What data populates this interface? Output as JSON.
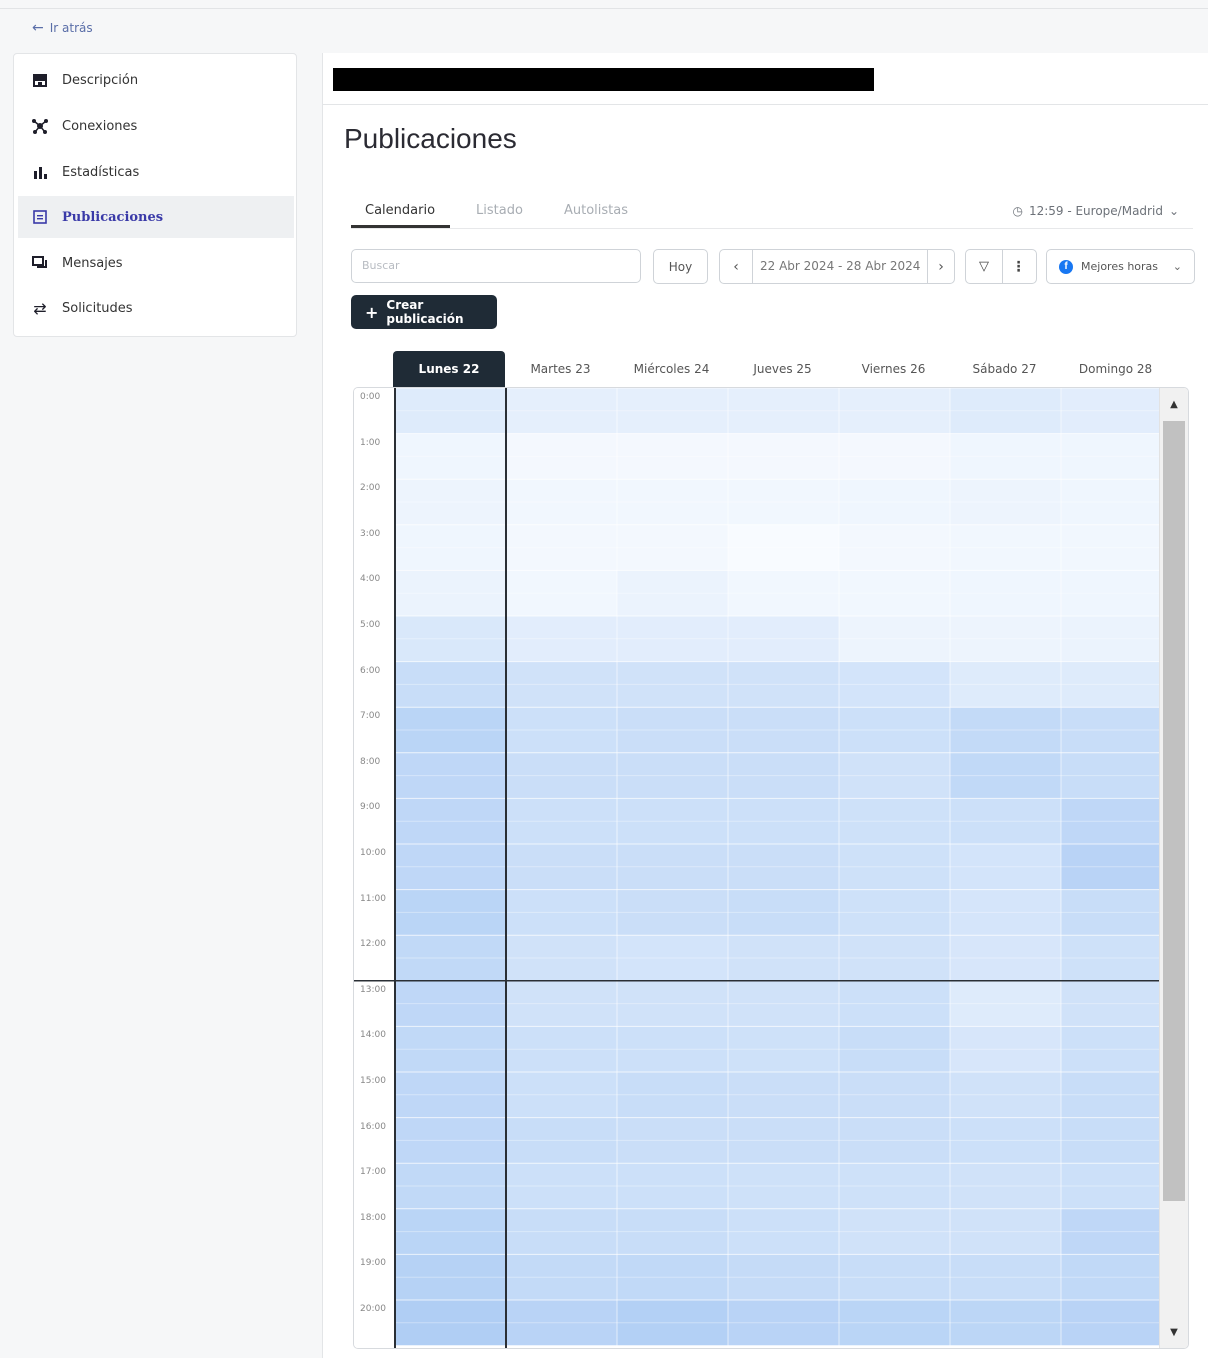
{
  "nav": {
    "back_label": "Ir atrás"
  },
  "sidebar": {
    "items": [
      {
        "label": "Descripción",
        "icon": "storefront-icon"
      },
      {
        "label": "Conexiones",
        "icon": "network-icon"
      },
      {
        "label": "Estadísticas",
        "icon": "bar-chart-icon"
      },
      {
        "label": "Publicaciones",
        "icon": "calendar-icon",
        "active": true
      },
      {
        "label": "Mensajes",
        "icon": "chat-icon"
      },
      {
        "label": "Solicitudes",
        "icon": "swap-arrows-icon"
      }
    ]
  },
  "page": {
    "title": "Publicaciones"
  },
  "tabs": {
    "calendar": "Calendario",
    "list": "Listado",
    "autolists": "Autolistas"
  },
  "timezone": {
    "label": "12:59 - Europe/Madrid"
  },
  "toolbar": {
    "search_placeholder": "Buscar",
    "today_label": "Hoy",
    "date_range": "22 Abr 2024 - 28 Abr 2024",
    "best_hours_label": "Mejores horas",
    "create_label": "Crear publicación"
  },
  "calendar": {
    "days": [
      "Lunes 22",
      "Martes 23",
      "Miércoles 24",
      "Jueves 25",
      "Viernes 26",
      "Sábado 27",
      "Domingo 28"
    ],
    "active_day_index": 0,
    "hours": [
      "0:00",
      "1:00",
      "2:00",
      "3:00",
      "4:00",
      "5:00",
      "6:00",
      "7:00",
      "8:00",
      "9:00",
      "10:00",
      "11:00",
      "12:00",
      "13:00",
      "14:00",
      "15:00",
      "16:00",
      "17:00",
      "18:00",
      "19:00",
      "20:00"
    ],
    "current_time_hour": 13.0,
    "best_hours_intensity": [
      [
        0.3,
        0.1,
        0.12,
        0.1,
        0.15,
        0.35,
        0.55,
        0.7,
        0.65,
        0.65,
        0.65,
        0.7,
        0.62,
        0.65,
        0.62,
        0.65,
        0.65,
        0.62,
        0.7,
        0.75,
        0.82
      ],
      [
        0.22,
        0.05,
        0.08,
        0.06,
        0.08,
        0.25,
        0.45,
        0.5,
        0.52,
        0.5,
        0.52,
        0.5,
        0.45,
        0.45,
        0.5,
        0.5,
        0.55,
        0.5,
        0.55,
        0.6,
        0.72
      ],
      [
        0.22,
        0.05,
        0.08,
        0.06,
        0.15,
        0.25,
        0.45,
        0.52,
        0.52,
        0.5,
        0.52,
        0.52,
        0.42,
        0.45,
        0.5,
        0.55,
        0.52,
        0.5,
        0.55,
        0.62,
        0.78
      ],
      [
        0.22,
        0.05,
        0.08,
        0.0,
        0.08,
        0.25,
        0.45,
        0.52,
        0.52,
        0.5,
        0.52,
        0.55,
        0.45,
        0.45,
        0.48,
        0.52,
        0.52,
        0.48,
        0.5,
        0.58,
        0.72
      ],
      [
        0.22,
        0.05,
        0.1,
        0.06,
        0.08,
        0.12,
        0.42,
        0.5,
        0.45,
        0.48,
        0.48,
        0.48,
        0.45,
        0.5,
        0.55,
        0.52,
        0.52,
        0.48,
        0.45,
        0.55,
        0.7
      ],
      [
        0.3,
        0.1,
        0.12,
        0.08,
        0.1,
        0.12,
        0.3,
        0.6,
        0.62,
        0.5,
        0.42,
        0.4,
        0.38,
        0.3,
        0.38,
        0.45,
        0.5,
        0.45,
        0.45,
        0.55,
        0.68
      ],
      [
        0.25,
        0.1,
        0.1,
        0.08,
        0.1,
        0.15,
        0.3,
        0.55,
        0.55,
        0.65,
        0.72,
        0.55,
        0.48,
        0.45,
        0.5,
        0.55,
        0.55,
        0.5,
        0.65,
        0.62,
        0.72
      ]
    ]
  }
}
